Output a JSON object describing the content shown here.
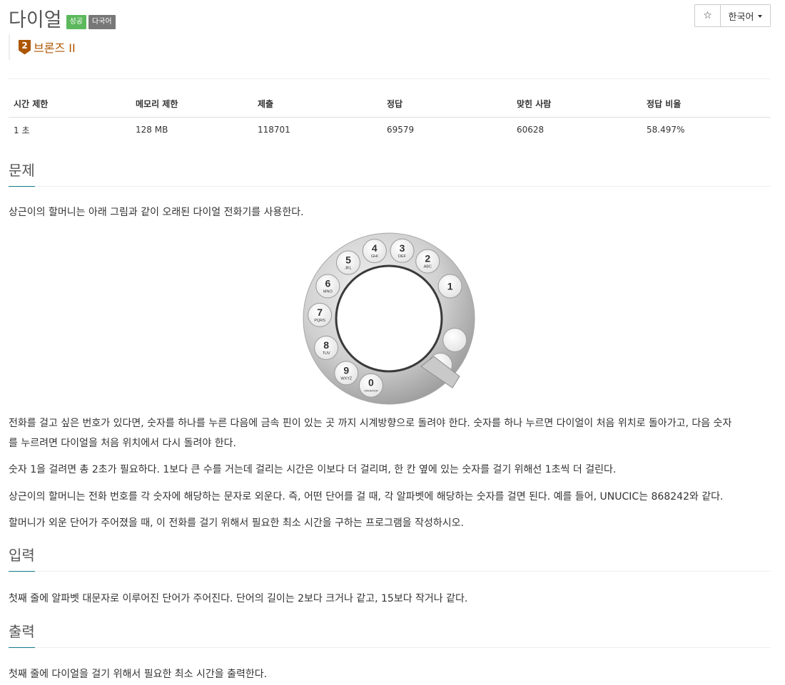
{
  "header": {
    "title": "다이얼",
    "badge_success": "성공",
    "badge_multilang": "다국어",
    "star_icon": "☆",
    "language": "한국어"
  },
  "tier": {
    "number": "2",
    "label": "브론즈 II"
  },
  "stats": {
    "headers": [
      "시간 제한",
      "메모리 제한",
      "제출",
      "정답",
      "맞힌 사람",
      "정답 비율"
    ],
    "values": [
      "1 초",
      "128 MB",
      "118701",
      "69579",
      "60628",
      "58.497%"
    ]
  },
  "sections": {
    "problem": {
      "title": "문제",
      "p1": "상근이의 할머니는 아래 그림과 같이 오래된 다이얼 전화기를 사용한다.",
      "p2a": "전화를 걸고 싶은 번호가 있다면, 숫자를 하나를 누른 다음에 금속 핀이 있는 곳 까지 시계방향으로 돌려야 한다. 숫자를 하나 누르면 다이얼이 처음 위치로 돌아가고, 다음 숫자",
      "p2b": "를 누르려면 다이얼을 처음 위치에서 다시 돌려야 한다.",
      "p3": "숫자 1을 걸려면 총 2초가 필요하다. 1보다 큰 수를 거는데 걸리는 시간은 이보다 더 걸리며, 한 칸 옆에 있는 숫자를 걸기 위해선 1초씩 더 걸린다.",
      "p4": "상근이의 할머니는 전화 번호를 각 숫자에 해당하는 문자로 외운다. 즉, 어떤 단어를 걸 때, 각 알파벳에 해당하는 숫자를 걸면 된다. 예를 들어, UNUCIC는 868242와 같다.",
      "p5": "할머니가 외운 단어가 주어졌을 때, 이 전화를 걸기 위해서 필요한 최소 시간을 구하는 프로그램을 작성하시오."
    },
    "input": {
      "title": "입력",
      "p1": "첫째 줄에 알파벳 대문자로 이루어진 단어가 주어진다. 단어의 길이는 2보다 크거나 같고, 15보다 작거나 같다."
    },
    "output": {
      "title": "출력",
      "p1": "첫째 줄에 다이얼을 걸기 위해서 필요한 최소 시간을 출력한다."
    }
  },
  "dial": {
    "holes": [
      {
        "num": "1",
        "letters": ""
      },
      {
        "num": "2",
        "letters": "ABC"
      },
      {
        "num": "3",
        "letters": "DEF"
      },
      {
        "num": "4",
        "letters": "GHI"
      },
      {
        "num": "5",
        "letters": "JKL"
      },
      {
        "num": "6",
        "letters": "MNO"
      },
      {
        "num": "7",
        "letters": "PQRS"
      },
      {
        "num": "8",
        "letters": "TUV"
      },
      {
        "num": "9",
        "letters": "WXYZ"
      },
      {
        "num": "0",
        "letters": "OPERATOR"
      },
      {
        "num": "",
        "letters": ""
      },
      {
        "num": "",
        "letters": ""
      }
    ]
  }
}
